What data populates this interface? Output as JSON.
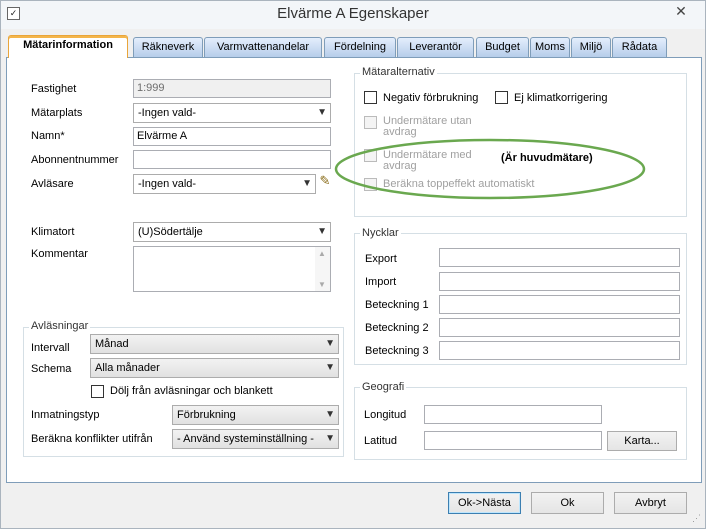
{
  "window": {
    "title": "Elvärme A Egenskaper",
    "close": "✕",
    "icon": "document-icon"
  },
  "tabs": [
    {
      "label": "Mätarinformation",
      "active": true
    },
    {
      "label": "Räkneverk"
    },
    {
      "label": "Varmvattenandelar"
    },
    {
      "label": "Fördelning"
    },
    {
      "label": "Leverantör"
    },
    {
      "label": "Budget"
    },
    {
      "label": "Moms"
    },
    {
      "label": "Miljö"
    },
    {
      "label": "Rådata"
    }
  ],
  "form": {
    "fastighet_label": "Fastighet",
    "fastighet_value": "1:999",
    "matarplats_label": "Mätarplats",
    "matarplats_value": "-Ingen vald-",
    "namn_label": "Namn*",
    "namn_value": "Elvärme A",
    "abonnentnummer_label": "Abonnentnummer",
    "abonnentnummer_value": "",
    "avlasare_label": "Avläsare",
    "avlasare_value": "-Ingen vald-",
    "klimatort_label": "Klimatort",
    "klimatort_value": "(U)Södertälje",
    "kommentar_label": "Kommentar",
    "kommentar_value": ""
  },
  "avlasningar": {
    "title": "Avläsningar",
    "intervall_label": "Intervall",
    "intervall_value": "Månad",
    "schema_label": "Schema",
    "schema_value": "Alla månader",
    "dolj_label": "Dölj från avläsningar och blankett",
    "inmatningstyp_label": "Inmatningstyp",
    "inmatningstyp_value": "Förbrukning",
    "konflikter_label": "Beräkna konflikter utifrån",
    "konflikter_value": "- Använd systeminställning -"
  },
  "mataralternativ": {
    "title": "Mätaralternativ",
    "negativ_label": "Negativ förbrukning",
    "klimat_label": "Ej klimatkorrigering",
    "undermatare_utan_label": "Undermätare utan avdrag",
    "undermatare_med_label": "Undermätare med avdrag",
    "huvudmatare_label": "(Är huvudmätare)",
    "toppeffekt_label": "Beräkna toppeffekt automatiskt",
    "annotation_color": "#6aa84f"
  },
  "nycklar": {
    "title": "Nycklar",
    "export_label": "Export",
    "import_label": "Import",
    "beteckning1_label": "Beteckning 1",
    "beteckning2_label": "Beteckning 2",
    "beteckning3_label": "Beteckning 3"
  },
  "geografi": {
    "title": "Geografi",
    "longitud_label": "Longitud",
    "latitud_label": "Latitud",
    "karta_label": "Karta..."
  },
  "buttons": {
    "ok_nasta": "Ok->Nästa",
    "ok": "Ok",
    "avbryt": "Avbryt"
  }
}
